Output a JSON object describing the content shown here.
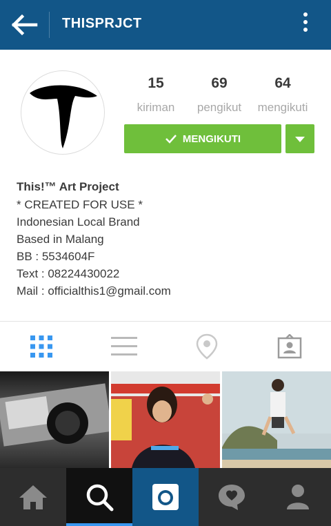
{
  "header": {
    "title": "THISPRJCT"
  },
  "stats": [
    {
      "value": "15",
      "label": "kiriman"
    },
    {
      "value": "69",
      "label": "pengikut"
    },
    {
      "value": "64",
      "label": "mengikuti"
    }
  ],
  "follow_button": {
    "label": "MENGIKUTI"
  },
  "bio": {
    "name": "This!™ Art Project",
    "lines": [
      "* CREATED FOR USE *",
      "Indonesian Local Brand",
      "Based in Malang",
      "BB : 5534604F",
      "Text : 08224430022",
      "Mail : officialthis1@gmail.com"
    ]
  },
  "view_tabs": [
    "grid-icon",
    "list-icon",
    "location-pin-icon",
    "tagged-photos-icon"
  ],
  "active_view_tab": "grid",
  "bottom_nav": [
    "home-icon",
    "search-icon",
    "camera-icon",
    "activity-heart-icon",
    "profile-icon"
  ],
  "active_nav": "search",
  "colors": {
    "header": "#125688",
    "follow": "#6fbf3b",
    "nav_bg": "#2d2d2d",
    "accent": "#3897f0"
  }
}
